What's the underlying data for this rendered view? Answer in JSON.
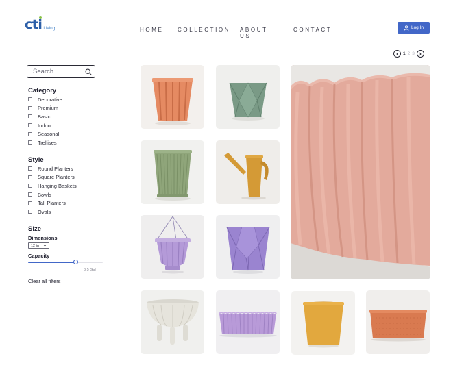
{
  "brand": {
    "logo_main": "cti",
    "logo_sub": "Living",
    "accent": "#2c5fa8"
  },
  "nav": {
    "items": [
      "HOME",
      "COLLECTION",
      "ABOUT US",
      "CONTACT"
    ]
  },
  "header": {
    "login_label": "Log In",
    "login_icon": "user-icon",
    "login_color": "#4267c8"
  },
  "pagination": {
    "pages": [
      "1",
      "2",
      "3"
    ],
    "current": "1"
  },
  "sidebar": {
    "search_placeholder": "Search",
    "category": {
      "title": "Category",
      "items": [
        "Decorative",
        "Premium",
        "Basic",
        "Indoor",
        "Seasonal",
        "Trellises"
      ]
    },
    "style": {
      "title": "Style",
      "items": [
        "Round Planters",
        "Square Planters",
        "Hanging Baskets",
        "Bowls",
        "Tall Planters",
        "Ovals"
      ]
    },
    "size": {
      "title": "Size",
      "dimensions_label": "Dimensions",
      "dimensions_value": "12 in",
      "capacity_label": "Capacity",
      "capacity_value": "3.5 Gal",
      "capacity_fraction": 0.64
    },
    "clear_label": "Clear all filters"
  },
  "products": [
    {
      "name": "Orange fluted planter",
      "color": "#e58a62"
    },
    {
      "name": "Green faceted planter",
      "color": "#7a9a86"
    },
    {
      "name": "Green ribbed planter",
      "color": "#8fa57a"
    },
    {
      "name": "Mustard watering can",
      "color": "#d49a36"
    },
    {
      "name": "Lavender hanging basket",
      "color": "#b49ad8"
    },
    {
      "name": "Purple faceted planter",
      "color": "#9a84d0"
    },
    {
      "name": "Cream footed bowl",
      "color": "#e6e4dc"
    },
    {
      "name": "Lavender scalloped oval",
      "color": "#b89ad8"
    },
    {
      "name": "Mustard round planter",
      "color": "#e2a83e"
    },
    {
      "name": "Terracotta oval planter",
      "color": "#d97a50"
    },
    {
      "name": "Pink scalloped planter featured",
      "color": "#e3aa9c"
    }
  ]
}
